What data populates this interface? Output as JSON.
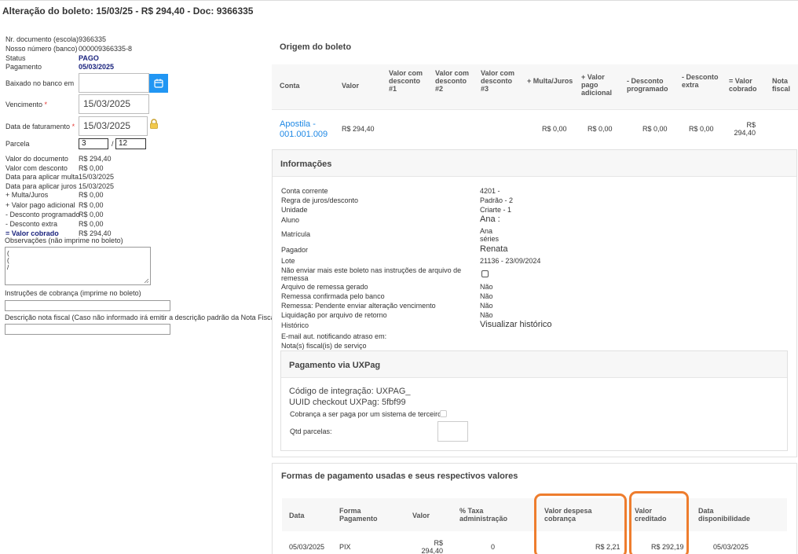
{
  "page_title": "Alteração do boleto: 15/03/25 - R$ 294,40 - Doc: 9366335",
  "left": {
    "nr_documento_label": "Nr. documento (escola)",
    "nr_documento_value": "9366335",
    "nosso_numero_label": "Nosso número (banco)",
    "nosso_numero_value": "000009366335-8",
    "status_label": "Status",
    "status_value": "PAGO",
    "pagamento_label": "Pagamento",
    "pagamento_value": "05/03/2025",
    "baixado_label": "Baixado no banco em",
    "baixado_value": "",
    "vencimento_label": "Vencimento",
    "vencimento_value": "15/03/2025",
    "faturamento_label": "Data de faturamento",
    "faturamento_value": "15/03/2025",
    "required_mark": "*",
    "parcela_label": "Parcela",
    "parcela_value": "3",
    "parcela_sep": "/",
    "parcela_total": "12",
    "summary": [
      {
        "label": "Valor do documento",
        "value": "R$ 294,40"
      },
      {
        "label": "Valor com desconto",
        "value": "R$ 0,00"
      },
      {
        "label": "Data para aplicar multa",
        "value": "15/03/2025"
      },
      {
        "label": "Data para aplicar juros",
        "value": "15/03/2025"
      },
      {
        "label": "+ Multa/Juros",
        "value": "R$ 0,00"
      },
      {
        "label": "+ Valor pago adicional",
        "value": "R$ 0,00"
      },
      {
        "label": "- Desconto programado",
        "value": "R$ 0,00"
      },
      {
        "label": "- Desconto extra",
        "value": "R$ 0,00"
      },
      {
        "label": "= Valor cobrado",
        "value": "R$ 294,40"
      }
    ],
    "observacoes_label": "Observações (não imprime no boleto)",
    "observacoes_lines": [
      "(",
      "(",
      "/"
    ],
    "instrucoes_label": "Instruções de cobrança (imprime no boleto)",
    "descricao_nf_label": "Descrição nota fiscal (Caso não informado irá emitir a descrição padrão da Nota Fiscal)"
  },
  "origem": {
    "title": "Origem do boleto",
    "headers": [
      "Conta",
      "Valor",
      "Valor com desconto #1",
      "Valor com desconto #2",
      "Valor com desconto #3",
      "+ Multa/Juros",
      "+ Valor pago adicional",
      "- Desconto programado",
      "- Desconto extra",
      "= Valor cobrado",
      "Nota fiscal"
    ],
    "row": {
      "conta": "Apostila - 001.001.009",
      "valor": "R$ 294,40",
      "multa": "R$ 0,00",
      "pago_adicional": "R$ 0,00",
      "desc_programado": "R$ 0,00",
      "desc_extra": "R$ 0,00",
      "valor_cobrado": "R$ 294,40"
    }
  },
  "informacoes": {
    "title": "Informações",
    "rows": [
      {
        "label": "Conta corrente",
        "value": "4201 -"
      },
      {
        "label": "Regra de juros/desconto",
        "value": "Padrão - 2"
      },
      {
        "label": "Unidade",
        "value": "Criarte - 1"
      },
      {
        "label": "Aluno",
        "value": "Ana :"
      },
      {
        "label": "Matrícula",
        "value": "Ana séries"
      },
      {
        "label": "Pagador",
        "value": "Renata"
      },
      {
        "label": "Lote",
        "value": "21136 - 23/09/2024"
      },
      {
        "label": "Não enviar mais este boleto nas instruções de arquivo de remessa",
        "value": ""
      },
      {
        "label": "Arquivo de remessa gerado",
        "value": "Não"
      },
      {
        "label": "Remessa confirmada pelo banco",
        "value": "Não"
      },
      {
        "label": "Remessa: Pendente enviar alteração vencimento",
        "value": "Não"
      },
      {
        "label": "Liquidação por arquivo de retorno",
        "value": "Não"
      },
      {
        "label": "Histórico",
        "value": "Visualizar histórico"
      },
      {
        "label": "E-mail aut. notificando atraso em:",
        "value": ""
      },
      {
        "label": "Nota(s) fiscal(is) de serviço",
        "value": ""
      }
    ]
  },
  "uxpag": {
    "title": "Pagamento via UXPag",
    "codigo": "Código de integração: UXPAG_",
    "uuid": "UUID checkout UXPag: 5fbf99",
    "terceiro_label": "Cobrança a ser paga por um sistema de terceiro",
    "qtd_label": "Qtd parcelas:"
  },
  "formas": {
    "title": "Formas de pagamento usadas e seus respectivos valores",
    "headers": [
      "Data",
      "Forma Pagamento",
      "Valor",
      "% Taxa administração",
      "Valor despesa cobrança",
      "Valor creditado",
      "Data disponibilidade"
    ],
    "row": {
      "data": "05/03/2025",
      "forma": "PIX",
      "valor": "R$ 294,40",
      "taxa": "0",
      "despesa": "R$ 2,21",
      "creditado": "R$ 292,19",
      "disponibilidade": "05/03/2025"
    }
  },
  "colors": {
    "accent": "#2196f3",
    "link": "#1e88e5",
    "highlight": "#ee7d2e",
    "status_blue": "#1a237e"
  },
  "icons": {
    "calendar": "calendar-icon",
    "lock": "lock-icon"
  }
}
